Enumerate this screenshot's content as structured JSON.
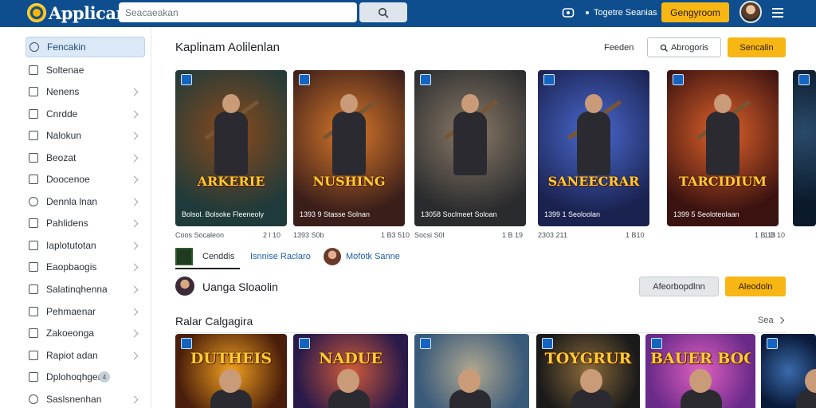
{
  "header": {
    "app_name": "Applican",
    "search_placeholder": "Seacaeakan",
    "link": "Togetre Seanias",
    "cta": "Gengyroom"
  },
  "sidebar": {
    "items": [
      {
        "label": "Fencakin",
        "active": true,
        "icon": "search-icon"
      },
      {
        "label": "Soltenae",
        "icon": "app-icon"
      },
      {
        "label": "Nenens",
        "icon": "list-icon"
      },
      {
        "label": "Cnrdde",
        "icon": "grid-icon"
      },
      {
        "label": "Nalokun",
        "icon": "folder-icon"
      },
      {
        "label": "Beozat",
        "icon": "box-icon"
      },
      {
        "label": "Doocenoe",
        "icon": "doc-icon"
      },
      {
        "label": "Dennla lnan",
        "icon": "link-icon"
      },
      {
        "label": "Pahlidens",
        "icon": "page-icon"
      },
      {
        "label": "Iaplotutotan",
        "icon": "chart-icon"
      },
      {
        "label": "Eaopbaogis",
        "icon": "settings-icon"
      },
      {
        "label": "Salatinqhenna",
        "icon": "tag-icon"
      },
      {
        "label": "Pehmaenar",
        "icon": "star-icon"
      },
      {
        "label": "Zakoeonga",
        "icon": "flag-icon"
      },
      {
        "label": "Rapiot adan",
        "icon": "bell-icon"
      },
      {
        "label": "Dplohoqhgen",
        "icon": "calendar-icon",
        "badge": "4"
      },
      {
        "label": "Saslsnenhan",
        "icon": "user-icon"
      }
    ]
  },
  "section1": {
    "title": "Kaplinam Aolilenlan",
    "label": "Feeden",
    "button1": "Abrogoris",
    "button2": "Sencalin"
  },
  "cards": [
    {
      "title": "ARKERIE",
      "caption": "Bolsol. Bolsoke Fleeneoly",
      "bg1": "#1f3a3a",
      "bg2": "#8a4a1c",
      "meta_left": "Coos Socaleon",
      "meta_right": "2 l 10"
    },
    {
      "title": "NUSHING",
      "caption": "1393 9 Stasse Solnan",
      "bg1": "#3a1e1a",
      "bg2": "#d9782a",
      "meta_left": "1393 S0b",
      "meta_right": "1 B3 510"
    },
    {
      "title": "",
      "caption": "13058 Soclmeet Soloan",
      "bg1": "#2a2b2e",
      "bg2": "#8a7a66",
      "meta_left": "Socsi S0l",
      "meta_right": "1 B 19"
    },
    {
      "title": "SANEECRAR",
      "caption": "1399 1 Seoloolan",
      "bg1": "#1a2250",
      "bg2": "#4a6ad0",
      "meta_left": "2303 211",
      "meta_right": "1 B10"
    },
    {
      "title": "TARCIDIUM",
      "caption": "1399 5 Seoloteolaan",
      "bg1": "#3a1210",
      "bg2": "#e0622a",
      "meta_left": "",
      "meta_right": "1 B 13"
    },
    {
      "title": "",
      "caption": "",
      "bg1": "#0a1a2a",
      "bg2": "#2a4a6a",
      "meta_left": "",
      "meta_right": "1 B 10"
    }
  ],
  "row2": {
    "item1": "Cenddis",
    "item2": "Isnnise Raclaro",
    "item3": "Mofotk Sanne"
  },
  "section2": {
    "title": "Uanga Sloaolin",
    "button1": "Afeorbopdlnn",
    "button2": "Aleodoln"
  },
  "section3": {
    "title": "Ralar Calgagira",
    "link": "Sea"
  },
  "cards2": [
    {
      "title": "DUTHEIS",
      "bg1": "#4a1e0a",
      "bg2": "#f0a020"
    },
    {
      "title": "NADUE",
      "bg1": "#2a1a4a",
      "bg2": "#d05a3a"
    },
    {
      "title": "",
      "bg1": "#3a5a7a",
      "bg2": "#b0a890"
    },
    {
      "title": "TOYGRUR",
      "bg1": "#1a1a1a",
      "bg2": "#8a6a3a"
    },
    {
      "title": "BAUER BOGON",
      "bg1": "#6a2a8a",
      "bg2": "#e060c0"
    },
    {
      "title": "",
      "bg1": "#0a1a3a",
      "bg2": "#3a6aaa"
    }
  ]
}
